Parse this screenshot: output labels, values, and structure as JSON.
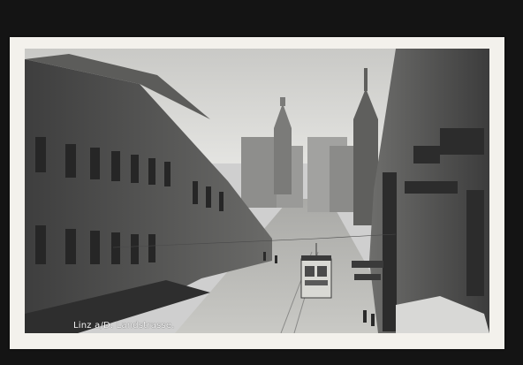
{
  "postcard": {
    "caption": "Linz a/D. Landstrasse.",
    "tram": {
      "route_sign": "",
      "colors": {
        "body": "#d9d9d4",
        "roof": "#3a3a3a"
      }
    },
    "palette": {
      "sky": "#d7d7d5",
      "building_dark": "#4a4a4a",
      "building_mid": "#8a8a88",
      "street": "#b8b8b5",
      "border": "#f3f1ec",
      "scan_bg": "#141414"
    }
  }
}
